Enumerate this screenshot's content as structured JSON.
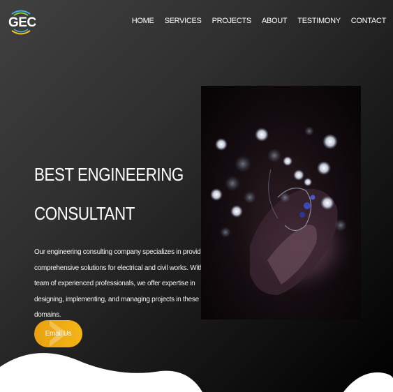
{
  "header": {
    "logo_text": "GEC",
    "nav": [
      {
        "label": "HOME"
      },
      {
        "label": "SERVICES"
      },
      {
        "label": "PROJECTS"
      },
      {
        "label": "ABOUT"
      },
      {
        "label": "TESTIMONY"
      },
      {
        "label": "CONTACT"
      }
    ]
  },
  "hero": {
    "title_line1": "BEST ENGINEERING",
    "title_line2": "CONSULTANT",
    "description": "Our engineering consulting company specializes in providing comprehensive solutions for electrical and civil works. With a team of experienced professionals, we offer expertise in designing, implementing, and managing projects in these domains.",
    "cta_label": "Email Us"
  },
  "colors": {
    "accent": "#f0ac12",
    "background_light": "#404040",
    "background_dark": "#000000",
    "text": "#ffffff",
    "logo_arc_1": "#3fb3e0",
    "logo_arc_2": "#9ad23a",
    "logo_arc_3": "#f0c020"
  },
  "icons": {
    "logo": "gec-logo-icon",
    "cta_chevron": "chevron-right-icon"
  }
}
